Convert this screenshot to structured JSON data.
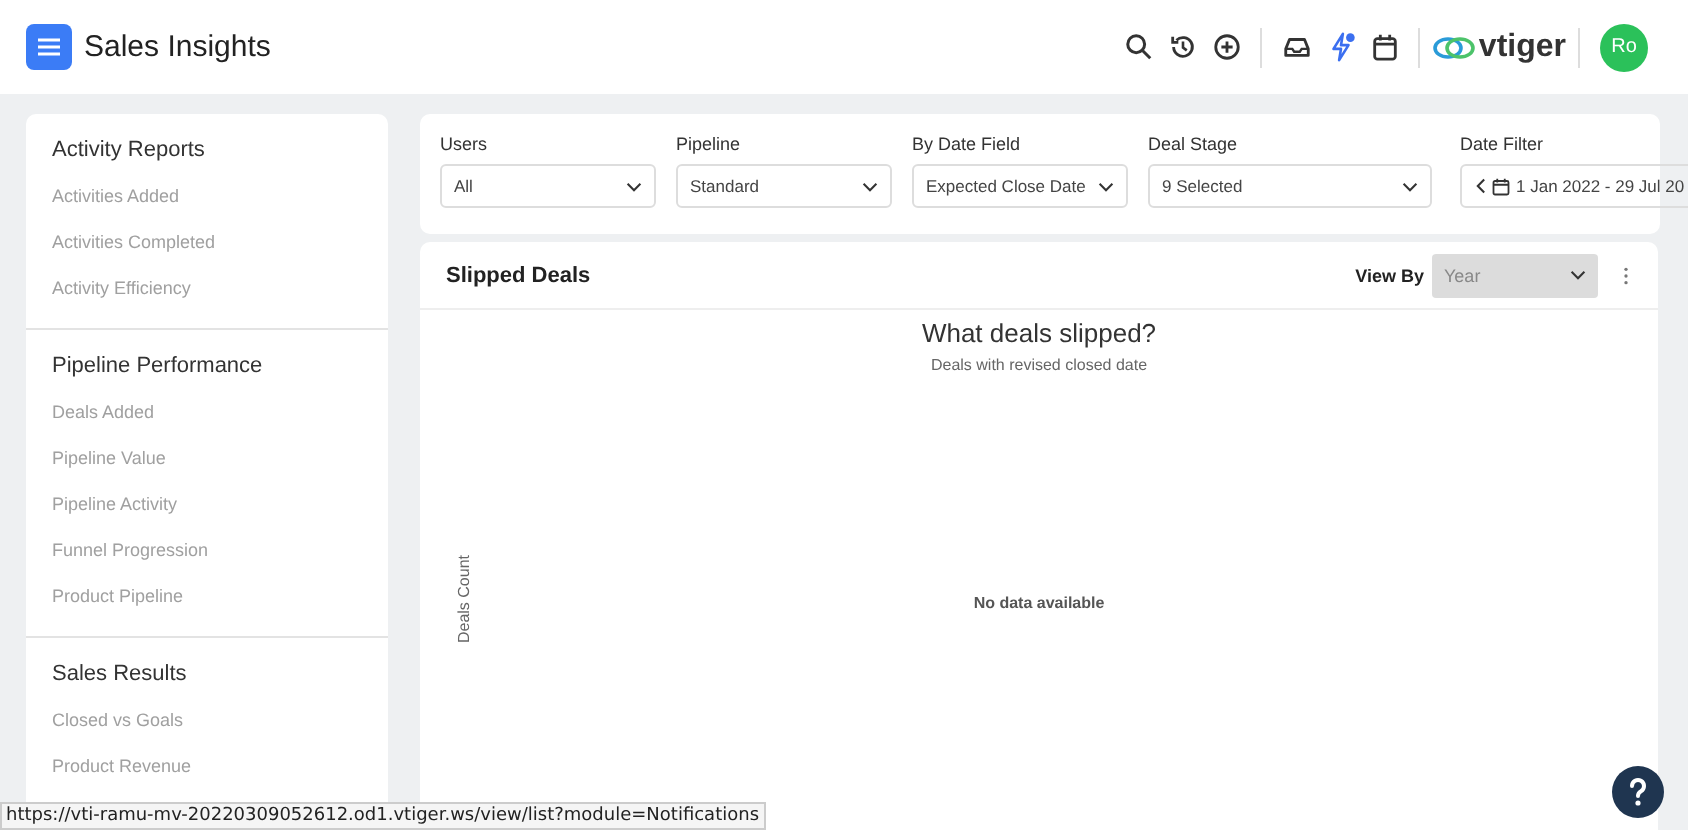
{
  "header": {
    "title": "Sales Insights",
    "logo_text": "vtiger",
    "avatar": "Ro",
    "notification_dot": true
  },
  "sidebar": {
    "sections": [
      {
        "title": "Activity Reports",
        "items": [
          "Activities Added",
          "Activities Completed",
          "Activity Efficiency"
        ]
      },
      {
        "title": "Pipeline Performance",
        "items": [
          "Deals Added",
          "Pipeline Value",
          "Pipeline Activity",
          "Funnel Progression",
          "Product Pipeline"
        ]
      },
      {
        "title": "Sales Results",
        "items": [
          "Closed vs Goals",
          "Product Revenue"
        ]
      }
    ]
  },
  "filters": [
    {
      "label": "Users",
      "value": "All",
      "kind": "select"
    },
    {
      "label": "Pipeline",
      "value": "Standard",
      "kind": "select"
    },
    {
      "label": "By Date Field",
      "value": "Expected Close Date",
      "kind": "select"
    },
    {
      "label": "Deal Stage",
      "value": "9 Selected",
      "kind": "select"
    },
    {
      "label": "Date Filter",
      "value": "1 Jan 2022 - 29 Jul 20",
      "kind": "date"
    }
  ],
  "chart_card": {
    "title": "Slipped Deals",
    "view_by_label": "View By",
    "view_by_value": "Year",
    "chart_title": "What deals slipped?",
    "chart_subtitle": "Deals with revised closed date",
    "ylabel": "Deals Count",
    "empty_message": "No data available"
  },
  "status_url": "https://vti-ramu-mv-20220309052612.od1.vtiger.ws/view/list?module=Notifications"
}
